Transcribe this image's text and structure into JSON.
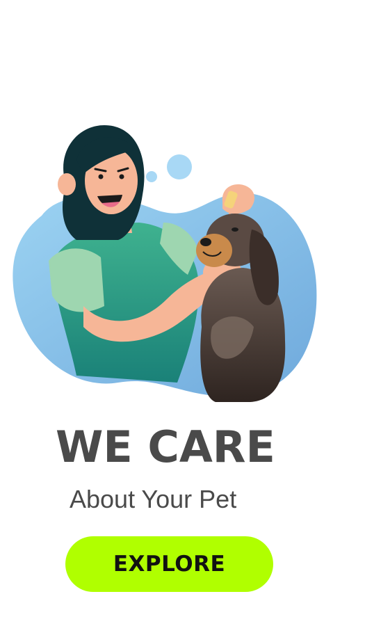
{
  "hero": {
    "illustration": "woman-giving-eye-drops-to-dog-illustration"
  },
  "headline": "WE CARE",
  "subheadline": "About Your Pet",
  "cta": {
    "label": "EXPLORE"
  },
  "colors": {
    "background": "#ffffff",
    "text": "#4a4a4a",
    "button": "#b0ff00",
    "button_text": "#111111",
    "blob_blue": "#9fd0f0",
    "shirt_green": "#2e9e83",
    "hair": "#0f3138",
    "skin": "#f6b697",
    "dog_brown": "#4e3f38"
  }
}
